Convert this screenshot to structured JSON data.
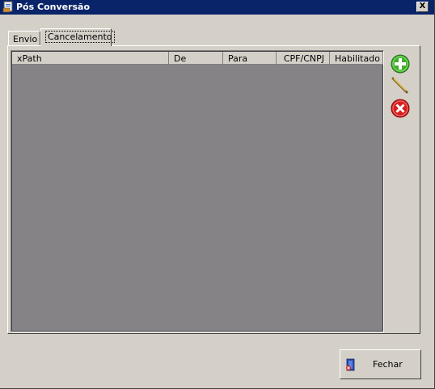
{
  "window": {
    "title": "Pós Conversão",
    "close_label": "X"
  },
  "tabs": [
    {
      "label": "Envio",
      "selected": false
    },
    {
      "label": "Cancelamento",
      "selected": true
    }
  ],
  "grid": {
    "columns": [
      "xPath",
      "De",
      "Para",
      "CPF/CNPJ",
      "Habilitado"
    ],
    "rows": []
  },
  "side_buttons": {
    "add_icon": "plus-circle-icon",
    "edit_icon": "pencil-icon",
    "delete_icon": "x-circle-icon"
  },
  "footer": {
    "close_label": "Fechar",
    "close_icon": "door-exit-icon"
  },
  "colors": {
    "titlebar": "#0a246a",
    "grid_background": "#858386",
    "add": "#3fae2a",
    "delete": "#d81e1e"
  }
}
